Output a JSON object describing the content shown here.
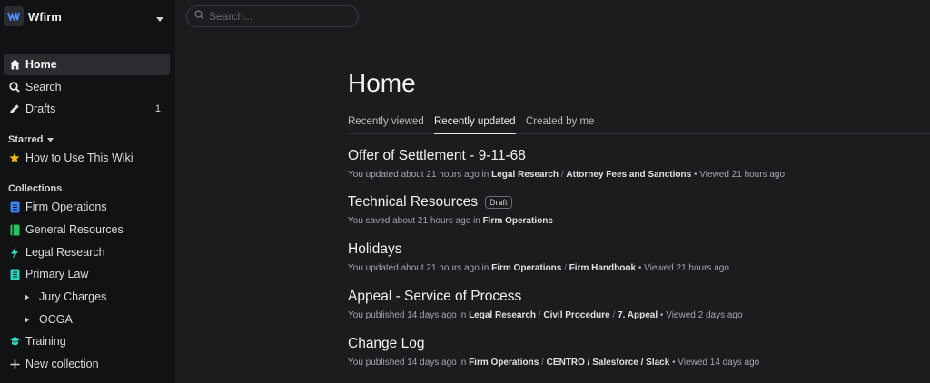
{
  "workspace": {
    "name": "Wfirm"
  },
  "nav": {
    "home": "Home",
    "search": "Search",
    "drafts": "Drafts",
    "drafts_count": "1"
  },
  "starred": {
    "header": "Starred",
    "items": [
      "How to Use This Wiki"
    ]
  },
  "collections": {
    "header": "Collections",
    "items": [
      "Firm Operations",
      "General Resources",
      "Legal Research",
      "Primary Law",
      "Jury Charges",
      "OCGA",
      "Training"
    ],
    "new_label": "New collection"
  },
  "search": {
    "placeholder": "Search..."
  },
  "page": {
    "title": "Home",
    "tabs": [
      "Recently viewed",
      "Recently updated",
      "Created by me"
    ],
    "active_tab": "Recently updated"
  },
  "documents": [
    {
      "title": "Offer of Settlement - 9-11-68",
      "action": "You updated about 21 hours ago in",
      "path": [
        "Legal Research",
        "Attorney Fees and Sanctions"
      ],
      "viewed": "Viewed 21 hours ago"
    },
    {
      "title": "Technical Resources",
      "badge": "Draft",
      "action": "You saved about 21 hours ago in",
      "path": [
        "Firm Operations"
      ]
    },
    {
      "title": "Holidays",
      "action": "You updated about 21 hours ago in",
      "path": [
        "Firm Operations",
        "Firm Handbook"
      ],
      "viewed": "Viewed 21 hours ago"
    },
    {
      "title": "Appeal - Service of Process",
      "action": "You published 14 days ago in",
      "path": [
        "Legal Research",
        "Civil Procedure",
        "7. Appeal"
      ],
      "viewed": "Viewed 2 days ago"
    },
    {
      "title": "Change Log",
      "action": "You published 14 days ago in",
      "path": [
        "Firm Operations",
        "CENTRO / Salesforce / Slack"
      ],
      "viewed": "Viewed 14 days ago"
    }
  ],
  "colors": {
    "firm_operations": "#3b82f6",
    "general_resources": "#22c55e",
    "legal_research": "#2dd4bf",
    "primary_law": "#2dd4bf",
    "training": "#2dd4bf",
    "star": "#f5b90b"
  }
}
